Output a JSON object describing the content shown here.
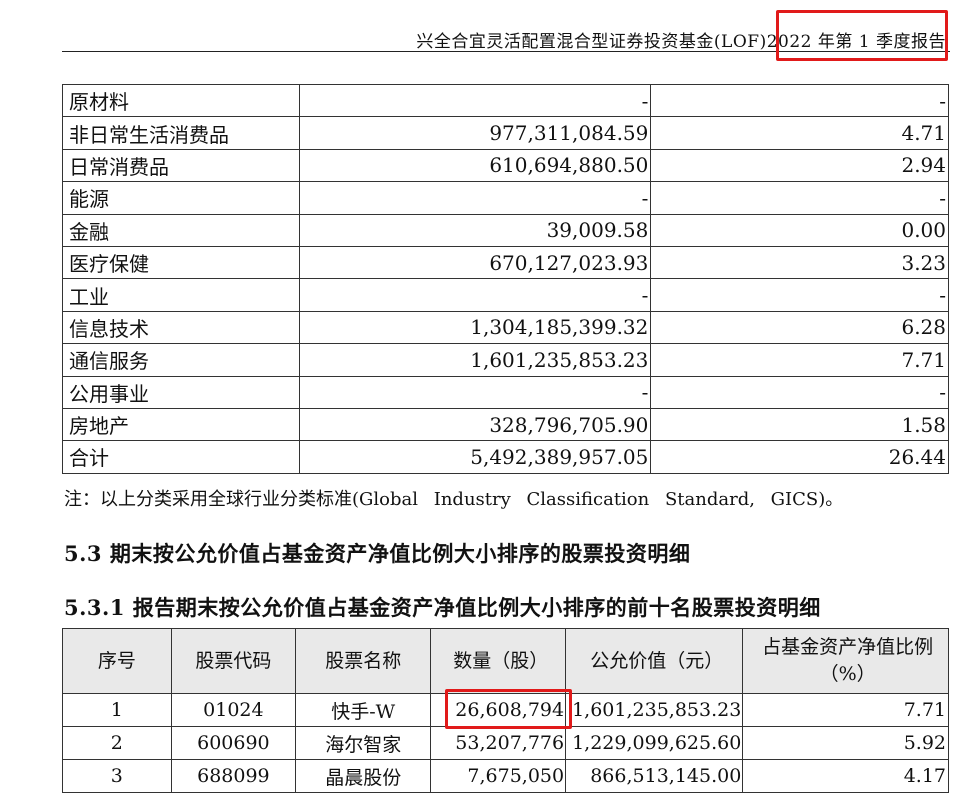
{
  "header": {
    "title": "兴全合宜灵活配置混合型证券投资基金(LOF)2022 年第 1 季度报告"
  },
  "industry_table": {
    "rows": [
      {
        "name": "原材料",
        "value": "-",
        "ratio": "-"
      },
      {
        "name": "非日常生活消费品",
        "value": "977,311,084.59",
        "ratio": "4.71"
      },
      {
        "name": "日常消费品",
        "value": "610,694,880.50",
        "ratio": "2.94"
      },
      {
        "name": "能源",
        "value": "-",
        "ratio": "-"
      },
      {
        "name": "金融",
        "value": "39,009.58",
        "ratio": "0.00"
      },
      {
        "name": "医疗保健",
        "value": "670,127,023.93",
        "ratio": "3.23"
      },
      {
        "name": "工业",
        "value": "-",
        "ratio": "-"
      },
      {
        "name": "信息技术",
        "value": "1,304,185,399.32",
        "ratio": "6.28"
      },
      {
        "name": "通信服务",
        "value": "1,601,235,853.23",
        "ratio": "7.71"
      },
      {
        "name": "公用事业",
        "value": "-",
        "ratio": "-"
      },
      {
        "name": "房地产",
        "value": "328,796,705.90",
        "ratio": "1.58"
      },
      {
        "name": "合计",
        "value": "5,492,389,957.05",
        "ratio": "26.44"
      }
    ]
  },
  "note": "注：以上分类采用全球行业分类标准(Global Industry Classification Standard, GICS)。",
  "section_5_3": "5.3 期末按公允价值占基金资产净值比例大小排序的股票投资明细",
  "section_5_3_1": "5.3.1 报告期末按公允价值占基金资产净值比例大小排序的前十名股票投资明细",
  "stock_table": {
    "headers": {
      "index": "序号",
      "code": "股票代码",
      "name": "股票名称",
      "quantity": "数量（股）",
      "fair_value": "公允价值（元）",
      "ratio_line1": "占基金资产净值比例",
      "ratio_line2": "（%）"
    },
    "rows": [
      {
        "index": "1",
        "code": "01024",
        "name": "快手-W",
        "quantity": "26,608,794",
        "fair_value": "1,601,235,853.23",
        "ratio": "7.71"
      },
      {
        "index": "2",
        "code": "600690",
        "name": "海尔智家",
        "quantity": "53,207,776",
        "fair_value": "1,229,099,625.60",
        "ratio": "5.92"
      },
      {
        "index": "3",
        "code": "688099",
        "name": "晶晨股份",
        "quantity": "7,675,050",
        "fair_value": "866,513,145.00",
        "ratio": "4.17"
      }
    ]
  },
  "colors": {
    "highlight": "#e11a1a",
    "header_bg": "#e9e9e9"
  }
}
